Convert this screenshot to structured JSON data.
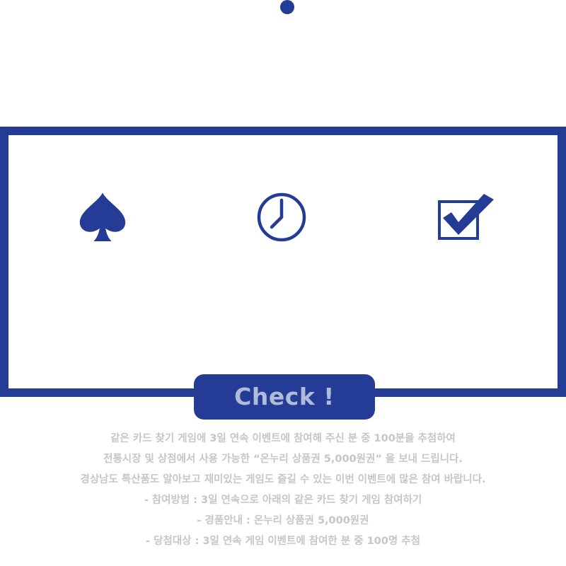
{
  "event": {
    "check_button_label": "Check !",
    "description_lines": [
      "같은 카드 찾기 게임에 3일 연속 이벤트에 참여해 주신 분 중 100분을 추첨하여",
      "전통시장 및 상점에서 사용 가능한 “온누리 상품권 5,000원권” 을 보내 드립니다.",
      "경상남도 특산품도 알아보고 재미있는 게임도 즐길 수 있는 이번 이벤트에 많은 참여 바랍니다.",
      "- 참여방법 : 3일 연속으로 아래의 같은 카드 찾기 게임 참여하기",
      "- 경품안내 : 온누리 상품권 5,000원권",
      "- 당첨대상 : 3일 연속 게임 이벤트에 참여한 분 중 100명 추첨"
    ]
  },
  "icons": [
    "spade-icon",
    "clock-icon",
    "checkbox-checked-icon"
  ],
  "colors": {
    "accent": "#253c97",
    "button_text": "#aebbd9",
    "description_text": "#c6c6c6",
    "background": "#ffffff"
  }
}
